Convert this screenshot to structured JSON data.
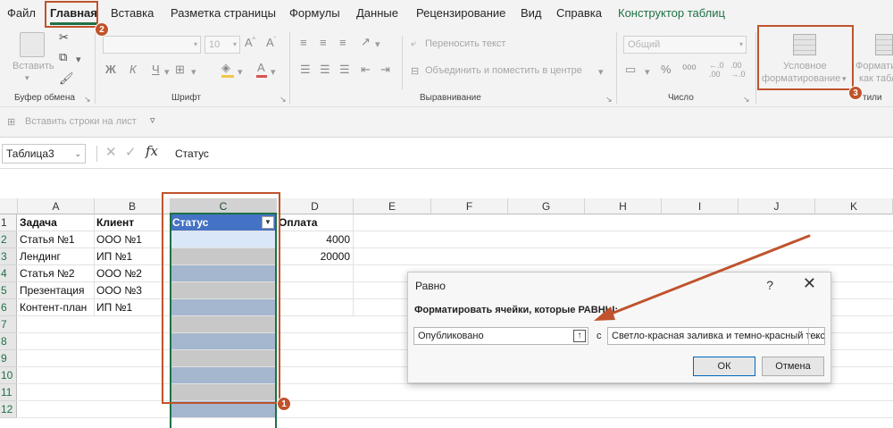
{
  "menu": [
    {
      "label": "Файл"
    },
    {
      "label": "Главная"
    },
    {
      "label": "Вставка"
    },
    {
      "label": "Разметка страницы"
    },
    {
      "label": "Формулы"
    },
    {
      "label": "Данные"
    },
    {
      "label": "Рецензирование"
    },
    {
      "label": "Вид"
    },
    {
      "label": "Справка"
    },
    {
      "label": "Конструктор таблиц"
    }
  ],
  "ribbon": {
    "paste_label": "Вставить",
    "clipboard_group": "Буфер обмена",
    "font_name": "",
    "font_size": "10",
    "font_group": "Шрифт",
    "bold": "Ж",
    "italic": "К",
    "underline": "Ч",
    "wrap_text": "Переносить текст",
    "merge_center": "Объединить и поместить в центре",
    "alignment_group": "Выравнивание",
    "number_format": "Общий",
    "number_group": "Число",
    "cond_format_line1": "Условное",
    "cond_format_line2": "форматирование",
    "format_table_line1": "Формати",
    "format_table_line2": "как табл",
    "styles_group": "тили",
    "insert_rows": "Вставить строки на лист"
  },
  "formula_bar": {
    "name_box": "Таблица3",
    "fx": "fx",
    "content": "Статус"
  },
  "columns": [
    "A",
    "B",
    "C",
    "D",
    "E",
    "F",
    "G",
    "H",
    "I",
    "J",
    "K"
  ],
  "rows": [
    "1",
    "2",
    "3",
    "4",
    "5",
    "6",
    "7",
    "8",
    "9",
    "10",
    "11",
    "12"
  ],
  "headers": {
    "a": "Задача",
    "b": "Клиент",
    "c": "Статус",
    "d": "Оплата"
  },
  "table_rows": [
    {
      "a": "Статья №1",
      "b": "ООО №1",
      "d": "4000"
    },
    {
      "a": "Лендинг",
      "b": "ИП №1",
      "d": "20000"
    },
    {
      "a": "Статья №2",
      "b": "ООО №2",
      "d": ""
    },
    {
      "a": "Презентация",
      "b": "ООО №3",
      "d": ""
    },
    {
      "a": "Контент-план",
      "b": "ИП №1",
      "d": ""
    }
  ],
  "dialog": {
    "title": "Равно",
    "help": "?",
    "close": "✕",
    "label": "Форматировать ячейки, которые РАВНЫ:",
    "value": "Опубликовано",
    "with": "с",
    "format_option": "Светло-красная заливка и темно-красный текст",
    "ok": "ОК",
    "cancel": "Отмена"
  },
  "badges": [
    "1",
    "2",
    "3"
  ],
  "colors": {
    "accent": "#1e7145",
    "annotation": "#c0532c",
    "table_header": "#4472c4",
    "stripe_blue": "#a4b7cf",
    "stripe_gray": "#c8c8c8"
  }
}
